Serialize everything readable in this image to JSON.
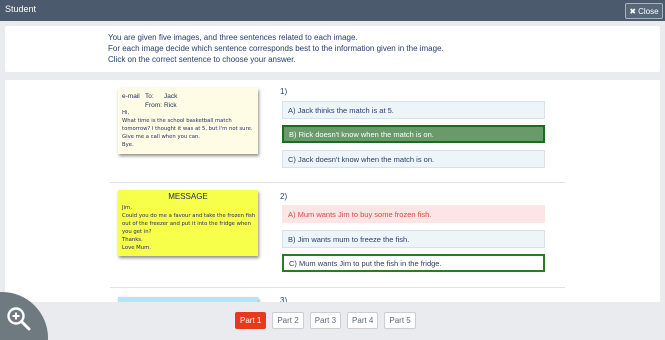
{
  "window": {
    "title": "Student",
    "close_label": "Close",
    "close_icon": "close-icon"
  },
  "instructions": {
    "line1": "You are given five images, and three sentences related to each image.",
    "line2": "For each image decide which sentence corresponds best to the information given in the image.",
    "line3": "Click on the correct sentence to choose your answer."
  },
  "questions": [
    {
      "number": "1)",
      "note": {
        "kind": "e-mail",
        "to_label": "To:",
        "to": "Jack",
        "from_label": "From:",
        "from": "Rick",
        "body": "Hi,\nWhat time is the school basketball match tomorrow? I thought it was at 5, but I'm not sure. Give me a call when you can.\nBye."
      },
      "answers": [
        {
          "text": "A) Jack thinks the match is at 5.",
          "state": "default"
        },
        {
          "text": "B) Rick doesn't know when the match is on.",
          "state": "selected-correct"
        },
        {
          "text": "C) Jack doesn't know when the match is on.",
          "state": "default"
        }
      ]
    },
    {
      "number": "2)",
      "note": {
        "heading": "MESSAGE",
        "body": "Jim,\nCould you do me a favour and take the frozen fish out of the freezer and put it into the fridge when you get in?\nThanks.\nLove Mum."
      },
      "answers": [
        {
          "text": "A) Mum wants Jim to buy some frozen fish.",
          "state": "wrong"
        },
        {
          "text": "B) Jim wants mum to freeze the fish.",
          "state": "default"
        },
        {
          "text": "C) Mum wants Jim to put the fish in the fridge.",
          "state": "correct"
        }
      ]
    },
    {
      "number": "3)"
    }
  ],
  "footer": {
    "parts": [
      "Part 1",
      "Part 2",
      "Part 3",
      "Part 4",
      "Part 5"
    ],
    "active_part": "Part 1"
  },
  "zoom": {
    "icon": "zoom-in-icon"
  },
  "colors": {
    "accent": "#e8391c",
    "correct_border": "#196c20",
    "wrong_text": "#e0463e",
    "titlebar": "#4b5a6c"
  }
}
